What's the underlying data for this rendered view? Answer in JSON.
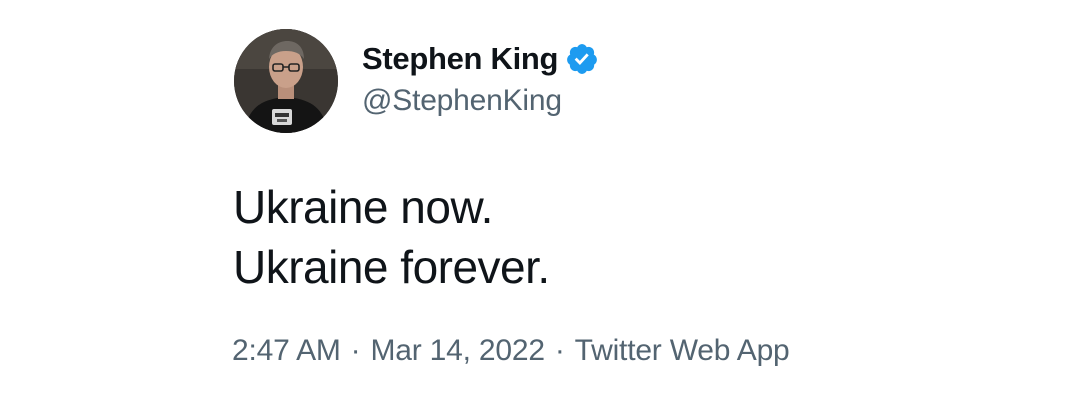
{
  "author": {
    "display_name": "Stephen King",
    "handle": "@StephenKing",
    "verified": true,
    "avatar_icon": "profile-photo",
    "verified_icon": "verified-badge-icon",
    "verified_color": "#1d9bf0"
  },
  "tweet": {
    "lines": [
      "Ukraine now.",
      "Ukraine forever."
    ]
  },
  "meta": {
    "time": "2:47 AM",
    "separator": "·",
    "date": "Mar 14, 2022",
    "source": "Twitter Web App"
  },
  "colors": {
    "text": "#0f1419",
    "secondary": "#536471",
    "background": "#ffffff"
  }
}
